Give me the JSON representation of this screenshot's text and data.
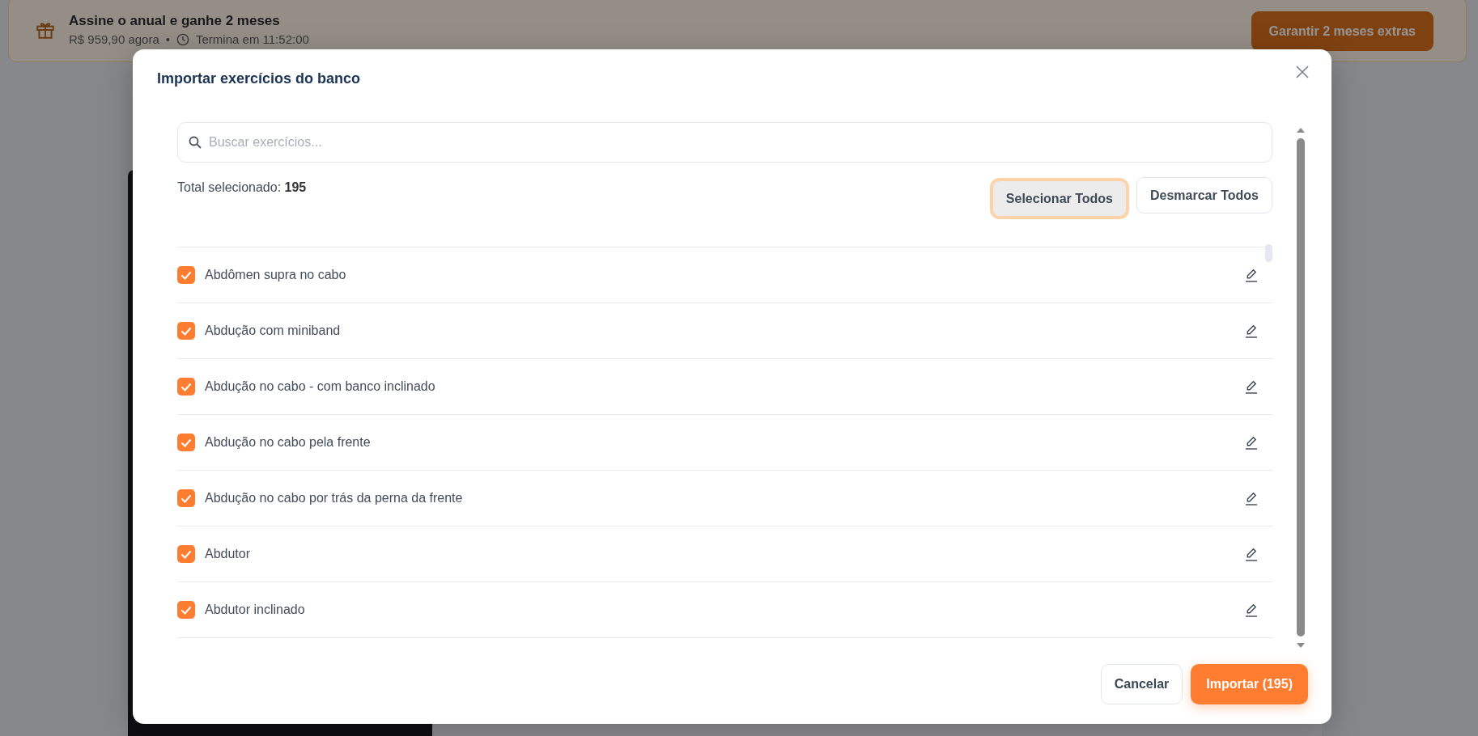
{
  "banner": {
    "title": "Assine o anual e ganhe 2 meses",
    "price": "R$ 959,90 agora",
    "separator": "•",
    "countdown": "Termina em 11:52:00",
    "button": "Garantir 2 meses extras"
  },
  "dialog": {
    "title": "Importar exercícios do banco",
    "search": {
      "placeholder": "Buscar exercícios..."
    },
    "total": "Total selecionado: **195**",
    "buttons": [
      {
        "label": "Selecionar Todos",
        "focused": true
      },
      {
        "label": "Desmarcar Todos",
        "focused": false
      }
    ],
    "exercises": [
      {
        "name": "Abdômen supra no cabo",
        "checked": true
      },
      {
        "name": "Abdução com miniband",
        "checked": true
      },
      {
        "name": "Abdução no cabo - com banco inclinado",
        "checked": true
      },
      {
        "name": "Abdução no cabo pela frente",
        "checked": true
      },
      {
        "name": "Abdução no cabo por trás da perna da frente",
        "checked": true
      },
      {
        "name": "Abdutor",
        "checked": true
      },
      {
        "name": "Abdutor inclinado",
        "checked": true
      }
    ],
    "footer": {
      "cancel": "Cancelar",
      "import": "Importar (195)"
    }
  }
}
